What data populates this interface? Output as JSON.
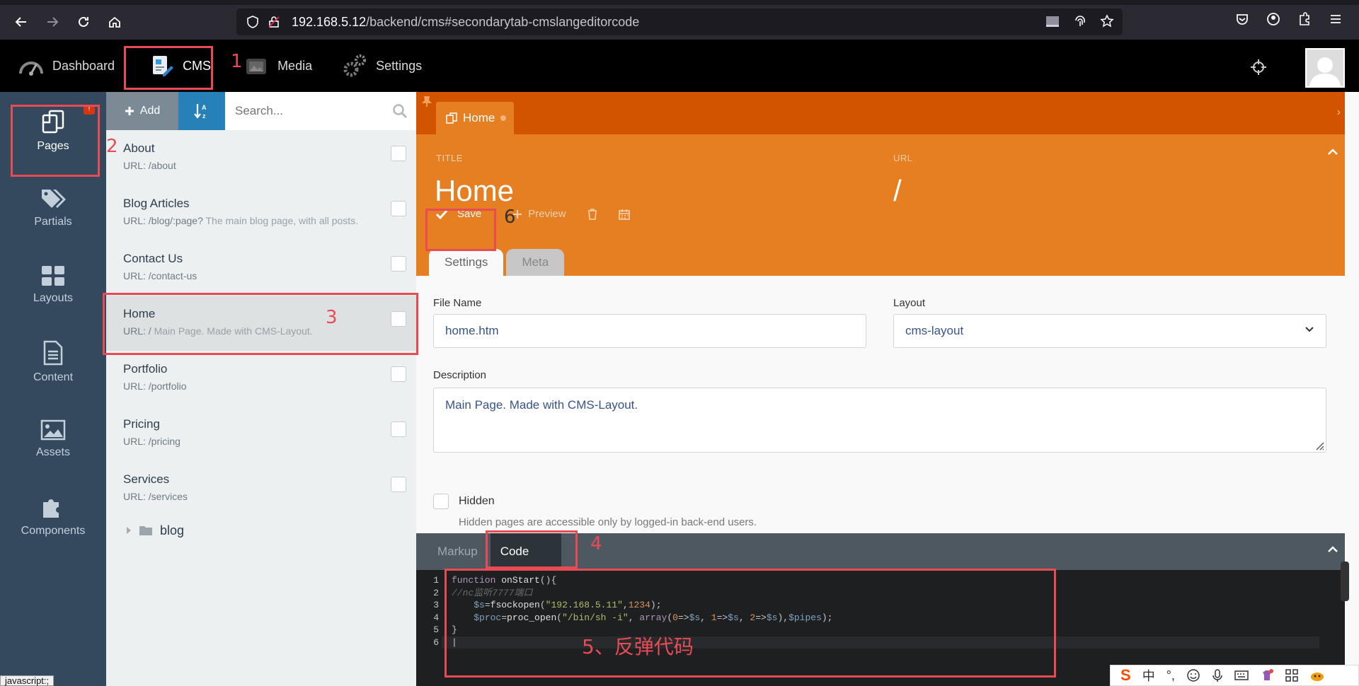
{
  "browser": {
    "url_host": "192.168.5.12",
    "url_path": "/backend/cms#secondarytab-cmslangeditorcode"
  },
  "topnav": {
    "items": [
      {
        "label": "Dashboard",
        "icon": "dashboard-icon"
      },
      {
        "label": "CMS",
        "icon": "cms-icon"
      },
      {
        "label": "Media",
        "icon": "media-icon"
      },
      {
        "label": "Settings",
        "icon": "gear-icon"
      }
    ],
    "active": "CMS"
  },
  "sidebar": {
    "items": [
      {
        "label": "Pages",
        "icon": "pages-icon"
      },
      {
        "label": "Partials",
        "icon": "tags-icon"
      },
      {
        "label": "Layouts",
        "icon": "grid-icon"
      },
      {
        "label": "Content",
        "icon": "file-text-icon"
      },
      {
        "label": "Assets",
        "icon": "image-icon"
      },
      {
        "label": "Components",
        "icon": "puzzle-icon"
      }
    ],
    "badge": "!"
  },
  "page_list": {
    "add_label": "Add",
    "search_placeholder": "Search...",
    "pages": [
      {
        "title": "About",
        "url": "URL: /about",
        "desc": ""
      },
      {
        "title": "Blog Articles",
        "url": "URL: /blog/:page?",
        "desc": "The main blog page, with all posts."
      },
      {
        "title": "Contact Us",
        "url": "URL: /contact-us",
        "desc": ""
      },
      {
        "title": "Home",
        "url": "URL: /",
        "desc": "Main Page. Made with CMS-Layout."
      },
      {
        "title": "Portfolio",
        "url": "URL: /portfolio",
        "desc": ""
      },
      {
        "title": "Pricing",
        "url": "URL: /pricing",
        "desc": ""
      },
      {
        "title": "Services",
        "url": "URL: /services",
        "desc": ""
      }
    ],
    "folder": "blog"
  },
  "editor": {
    "tab_label": "Home",
    "title_label": "TITLE",
    "title_value": "Home",
    "url_label": "URL",
    "url_value": "/",
    "save_label": "Save",
    "preview_label": "Preview",
    "subtabs": [
      "Settings",
      "Meta"
    ],
    "file_name_label": "File Name",
    "file_name_value": "home.htm",
    "layout_label": "Layout",
    "layout_value": "cms-layout",
    "description_label": "Description",
    "description_value": "Main Page. Made with CMS-Layout.",
    "hidden_label": "Hidden",
    "hidden_help": "Hidden pages are accessible only by logged-in back-end users.",
    "code_tabs": [
      "Markup",
      "Code"
    ],
    "line_numbers": [
      "1",
      "2",
      "3",
      "4",
      "5",
      "6"
    ]
  },
  "annotations": {
    "n1": "1",
    "n2": "2",
    "n3": "3",
    "n4": "4",
    "n6": "6",
    "n5_text": "5、反弹代码"
  },
  "status_tip": "javascript:;",
  "ime": {
    "lang": "中",
    "punct": "°,"
  },
  "colors": {
    "accent_orange": "#e67e22",
    "tab_strip": "#d35400",
    "sidebar_bg": "#34495e",
    "annotation_red": "#e94b55"
  }
}
